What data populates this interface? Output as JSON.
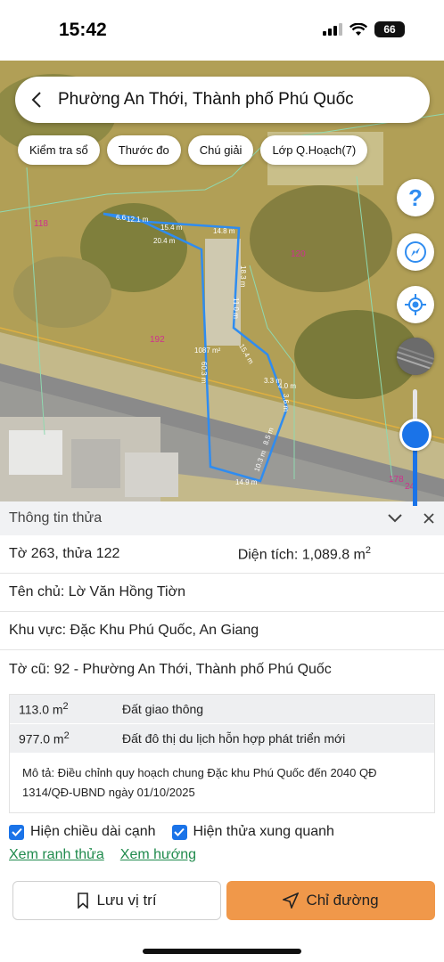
{
  "status_bar": {
    "time": "15:42",
    "battery": "66"
  },
  "search": {
    "title": "Phường An Thới, Thành phố Phú Quốc"
  },
  "chips": [
    "Kiểm tra sổ",
    "Thước đo",
    "Chú giải",
    "Lớp Q.Hoạch(7)"
  ],
  "map": {
    "parcel_labels": {
      "left": "118",
      "right": "120",
      "middle": "192",
      "bottom_right_1": "178",
      "bottom_right_2": "24"
    },
    "edge_labels": [
      "6.6",
      "12.1 m",
      "15.4 m",
      "14.8 m",
      "20.4 m",
      "18.3 m",
      "11.0 m",
      "60.3 m",
      "15.4 m",
      "3.3 m",
      "4.0 m",
      "3.6 m",
      "8.5 m",
      "10.3 m",
      "14.9 m"
    ],
    "area_label": "1087 m²",
    "colors": {
      "boundary": "#2f8cf0",
      "road": "#8a8a8a",
      "vegetation": "#5f7a2e"
    }
  },
  "map_controls": [
    "help-icon",
    "compass-icon",
    "locate-icon",
    "layer-icon"
  ],
  "panel": {
    "header": "Thông tin thửa",
    "sheet_parcel": "Tờ 263, thửa 122",
    "area_label": "Diện tích: 1,089.8 m",
    "area_sup": "2",
    "owner": "Tên chủ: Lờ Văn Hồng Tiờn",
    "region": "Khu vực: Đặc Khu Phú Quốc, An Giang",
    "old_sheet": "Tờ cũ: 92 - Phường An Thới, Thành phố Phú Quốc",
    "land_uses": [
      {
        "area": "113.0 m",
        "sup": "2",
        "type": "Đất giao thông"
      },
      {
        "area": "977.0 m",
        "sup": "2",
        "type": "Đất đô thị du lịch hỗn hợp phát triển mới"
      }
    ],
    "description": "Mô tả: Điều chỉnh quy hoạch chung Đặc khu Phú Quốc đến 2040 QĐ 1314/QĐ-UBND ngày 01/10/2025",
    "check_edges": "Hiện chiều dài cạnh",
    "check_neighbors": "Hiện thửa xung quanh",
    "link_boundary": "Xem ranh thửa",
    "link_direction": "Xem hướng",
    "btn_save": "Lưu vị trí",
    "btn_directions": "Chỉ đường"
  }
}
